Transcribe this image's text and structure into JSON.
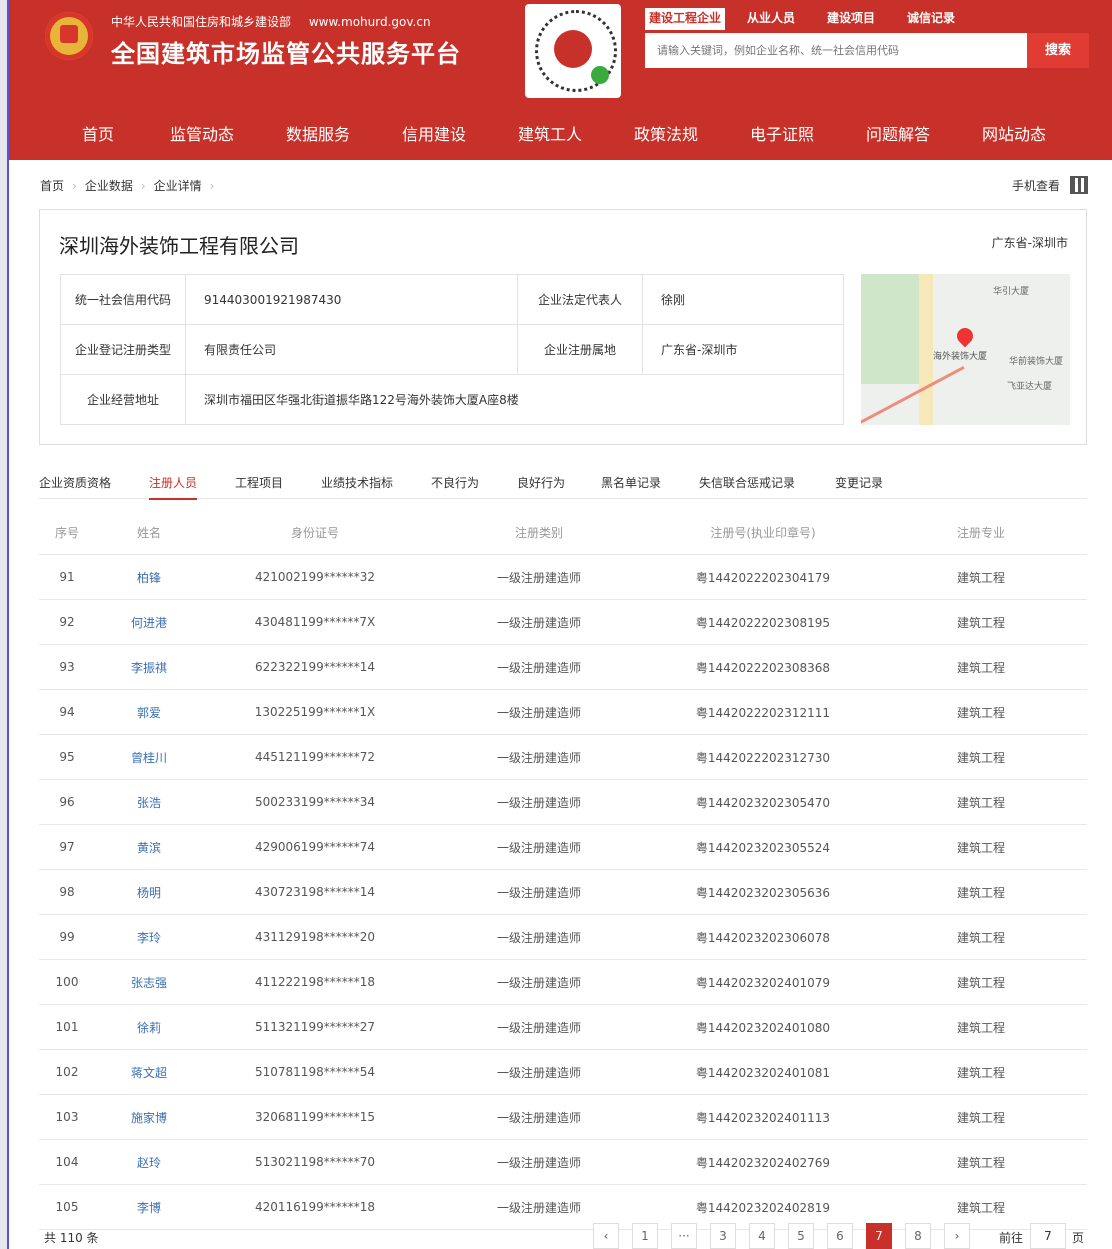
{
  "header": {
    "gov_name": "中华人民共和国住房和城乡建设部",
    "gov_url": "www.mohurd.gov.cn",
    "site_title": "全国建筑市场监管公共服务平台",
    "search_tabs": [
      "建设工程企业",
      "从业人员",
      "建设项目",
      "诚信记录"
    ],
    "search_placeholder": "请输入关键词，例如企业名称、统一社会信用代码",
    "search_button": "搜索",
    "brand_color": "#c8312a"
  },
  "nav": [
    "首页",
    "监管动态",
    "数据服务",
    "信用建设",
    "建筑工人",
    "政策法规",
    "电子证照",
    "问题解答",
    "网站动态"
  ],
  "breadcrumb": [
    "首页",
    "企业数据",
    "企业详情"
  ],
  "mobile_view": "手机查看",
  "company": {
    "name": "深圳海外装饰工程有限公司",
    "region": "广东省-深圳市",
    "fields": {
      "credit_code_label": "统一社会信用代码",
      "credit_code": "914403001921987430",
      "legal_rep_label": "企业法定代表人",
      "legal_rep": "徐刚",
      "reg_type_label": "企业登记注册类型",
      "reg_type": "有限责任公司",
      "reg_place_label": "企业注册属地",
      "reg_place": "广东省-深圳市",
      "address_label": "企业经营地址",
      "address": "深圳市福田区华强北街道振华路122号海外装饰大厦A座8楼"
    },
    "map_labels": [
      "华引大厦",
      "海外装饰大厦",
      "华前装饰大厦",
      "飞亚达大厦"
    ]
  },
  "tabs": [
    "企业资质资格",
    "注册人员",
    "工程项目",
    "业绩技术指标",
    "不良行为",
    "良好行为",
    "黑名单记录",
    "失信联合惩戒记录",
    "变更记录"
  ],
  "active_tab": "注册人员",
  "table": {
    "headers": [
      "序号",
      "姓名",
      "身份证号",
      "注册类别",
      "注册号(执业印章号)",
      "注册专业"
    ],
    "rows": [
      [
        "91",
        "柏锋",
        "421002199******32",
        "一级注册建造师",
        "粤1442022202304179",
        "建筑工程"
      ],
      [
        "92",
        "何进港",
        "430481199******7X",
        "一级注册建造师",
        "粤1442022202308195",
        "建筑工程"
      ],
      [
        "93",
        "李振祺",
        "622322199******14",
        "一级注册建造师",
        "粤1442022202308368",
        "建筑工程"
      ],
      [
        "94",
        "郭爱",
        "130225199******1X",
        "一级注册建造师",
        "粤1442022202312111",
        "建筑工程"
      ],
      [
        "95",
        "曾桂川",
        "445121199******72",
        "一级注册建造师",
        "粤1442022202312730",
        "建筑工程"
      ],
      [
        "96",
        "张浩",
        "500233199******34",
        "一级注册建造师",
        "粤1442023202305470",
        "建筑工程"
      ],
      [
        "97",
        "黄滨",
        "429006199******74",
        "一级注册建造师",
        "粤1442023202305524",
        "建筑工程"
      ],
      [
        "98",
        "杨明",
        "430723198******14",
        "一级注册建造师",
        "粤1442023202305636",
        "建筑工程"
      ],
      [
        "99",
        "李玲",
        "431129198******20",
        "一级注册建造师",
        "粤1442023202306078",
        "建筑工程"
      ],
      [
        "100",
        "张志强",
        "411222198******18",
        "一级注册建造师",
        "粤1442023202401079",
        "建筑工程"
      ],
      [
        "101",
        "徐莉",
        "511321199******27",
        "一级注册建造师",
        "粤1442023202401080",
        "建筑工程"
      ],
      [
        "102",
        "蒋文超",
        "510781198******54",
        "一级注册建造师",
        "粤1442023202401081",
        "建筑工程"
      ],
      [
        "103",
        "施家博",
        "320681199******15",
        "一级注册建造师",
        "粤1442023202401113",
        "建筑工程"
      ],
      [
        "104",
        "赵玲",
        "513021198******70",
        "一级注册建造师",
        "粤1442023202402769",
        "建筑工程"
      ],
      [
        "105",
        "李博",
        "420116199******18",
        "一级注册建造师",
        "粤1442023202402819",
        "建筑工程"
      ]
    ]
  },
  "pagination": {
    "total": "共 110 条",
    "prev": "‹",
    "next": "›",
    "ellipsis": "···",
    "pages": [
      "1",
      "3",
      "4",
      "5",
      "6",
      "7",
      "8"
    ],
    "current": "7",
    "goto_label": "前往",
    "goto_value": "7",
    "page_suffix": "页"
  }
}
